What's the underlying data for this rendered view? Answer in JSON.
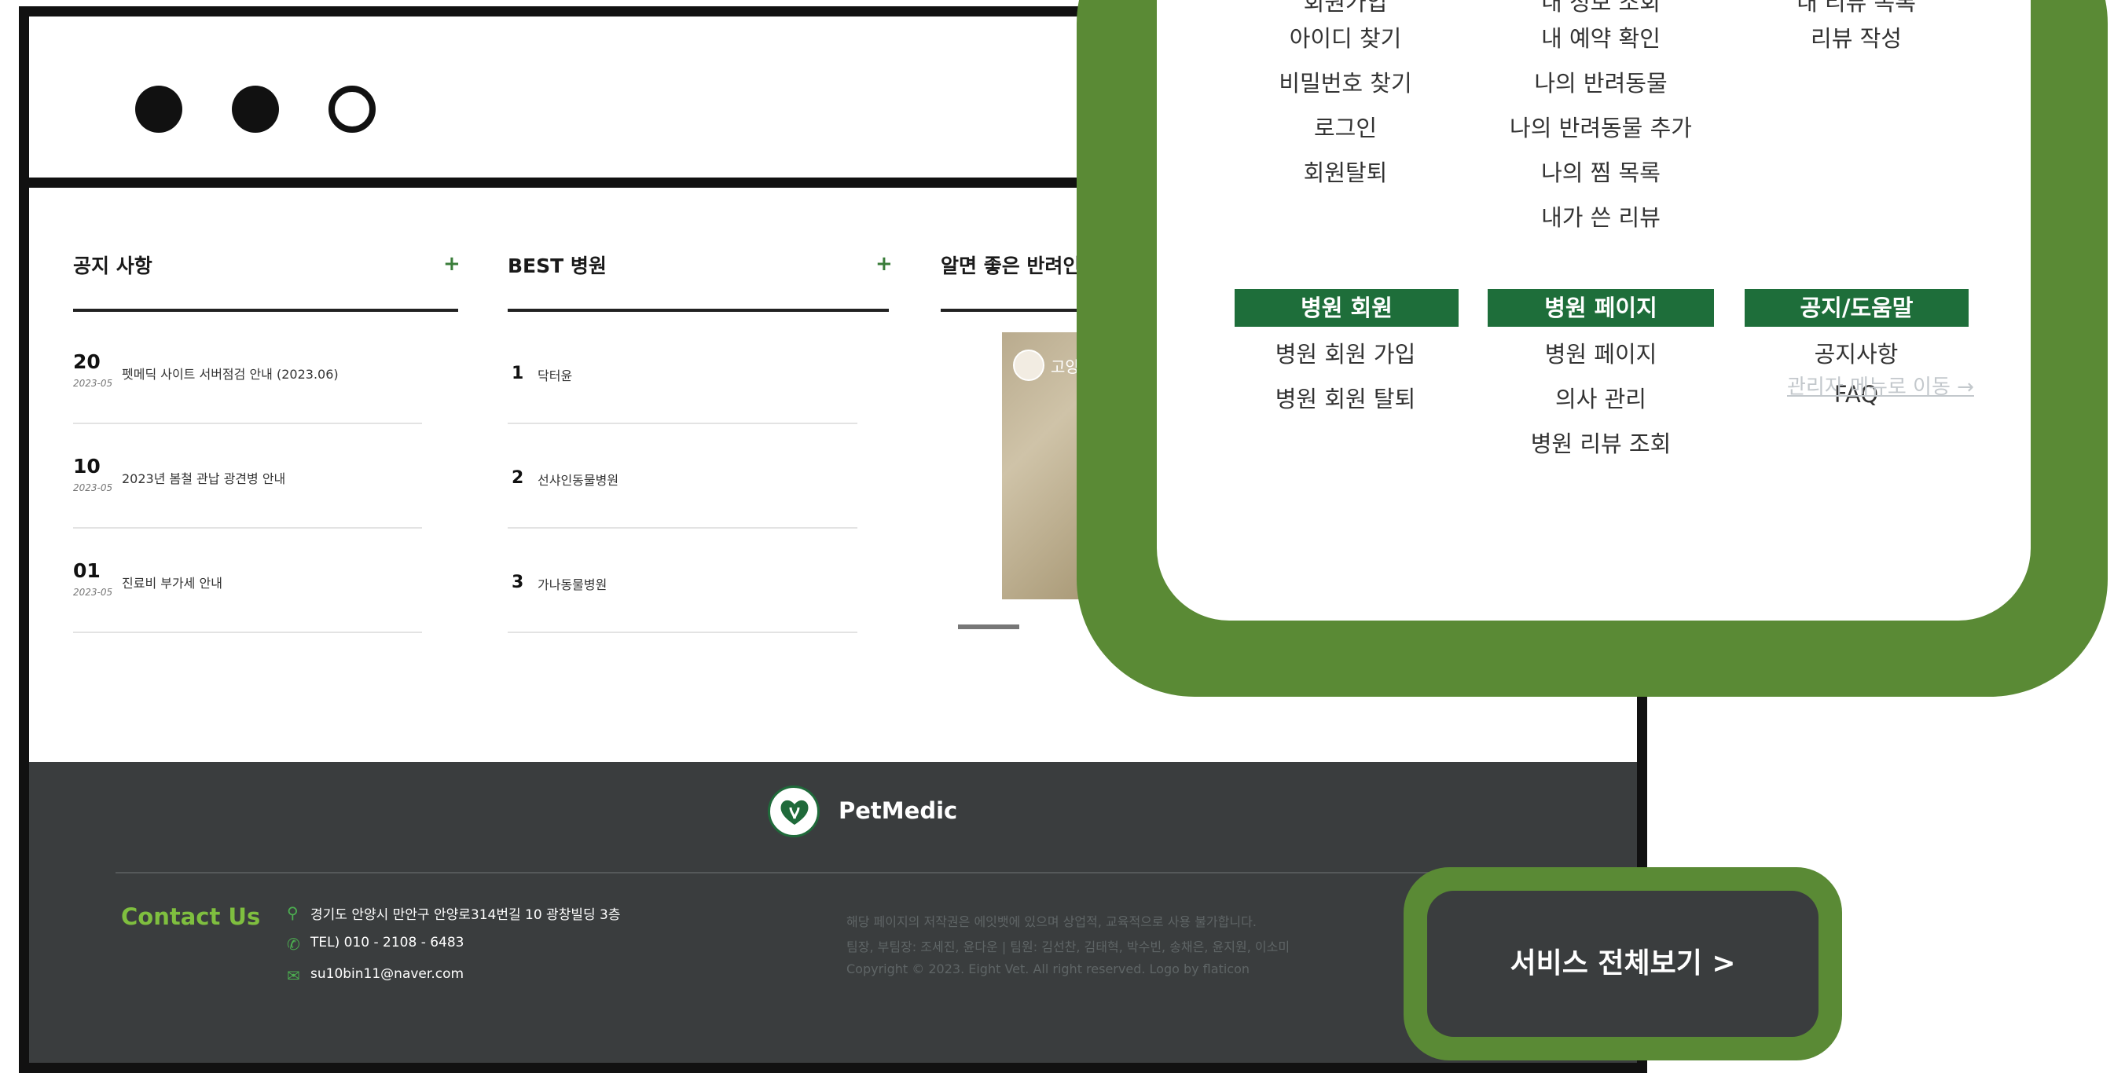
{
  "notice": {
    "title": "공지 사항",
    "plus": "+",
    "items": [
      {
        "day": "20",
        "ym": "2023-05",
        "text": "펫메딕 사이트 서버점검 안내 (2023.06)"
      },
      {
        "day": "10",
        "ym": "2023-05",
        "text": "2023년 봄철 관납 광견병 안내"
      },
      {
        "day": "01",
        "ym": "2023-05",
        "text": "진료비 부가세 안내"
      }
    ]
  },
  "best": {
    "title": "BEST 병원",
    "plus": "+",
    "items": [
      {
        "rank": "1",
        "name": "닥터윤"
      },
      {
        "rank": "2",
        "name": "선샤인동물병원"
      },
      {
        "rank": "3",
        "name": "가나동물병원"
      }
    ]
  },
  "tips": {
    "title": "알면 좋은 반려인 ",
    "photo_text": "고양"
  },
  "footer": {
    "brand": "PetMedic",
    "contact_label": "Contact Us",
    "address": "경기도 안양시 만안구 안양로314번길 10 광창빌딩 3층",
    "tel": "TEL) 010 - 2108 - 6483",
    "email": "su10bin11@naver.com",
    "legal": [
      "해당 페이지의 저작권은 에잇뱃에 있으며 상업적, 교육적으로 사용 불가합니다.",
      "팀장, 부팀장: 조세진, 윤다운 | 팀원: 김선찬, 김태혁, 박수빈, 송채은, 윤지원, 이소미",
      "Copyright © 2023. Eight Vet. All right reserved. Logo by flaticon"
    ]
  },
  "menu": {
    "top_row": {
      "col2": "내 정보 조회",
      "col3": "내 리뷰 목록"
    },
    "col1": [
      "회원가입",
      "아이디 찾기",
      "비밀번호 찾기",
      "로그인",
      "회원탈퇴"
    ],
    "col2": [
      "내 예약 확인",
      "나의 반려동물",
      "나의 반려동물 추가",
      "나의 찜 목록",
      "내가 쓴 리뷰"
    ],
    "col3": [
      "리뷰 작성"
    ],
    "sections": [
      {
        "header": "병원 회원",
        "items": [
          "병원 회원 가입",
          "병원 회원 탈퇴"
        ]
      },
      {
        "header": "병원 페이지",
        "items": [
          "병원 페이지",
          "의사 관리",
          "병원 리뷰 조회"
        ]
      },
      {
        "header": "공지/도움말",
        "items": [
          "공지사항",
          "FAQ"
        ]
      }
    ],
    "admin_link": "관리자 메뉴로 이동 →"
  },
  "service_button": "서비스 전체보기 >",
  "colors": {
    "accent_green": "#5a8a35",
    "menu_header": "#1e6e3a",
    "footer_bg": "#3a3d3e",
    "contact_green": "#7fbf3f"
  }
}
